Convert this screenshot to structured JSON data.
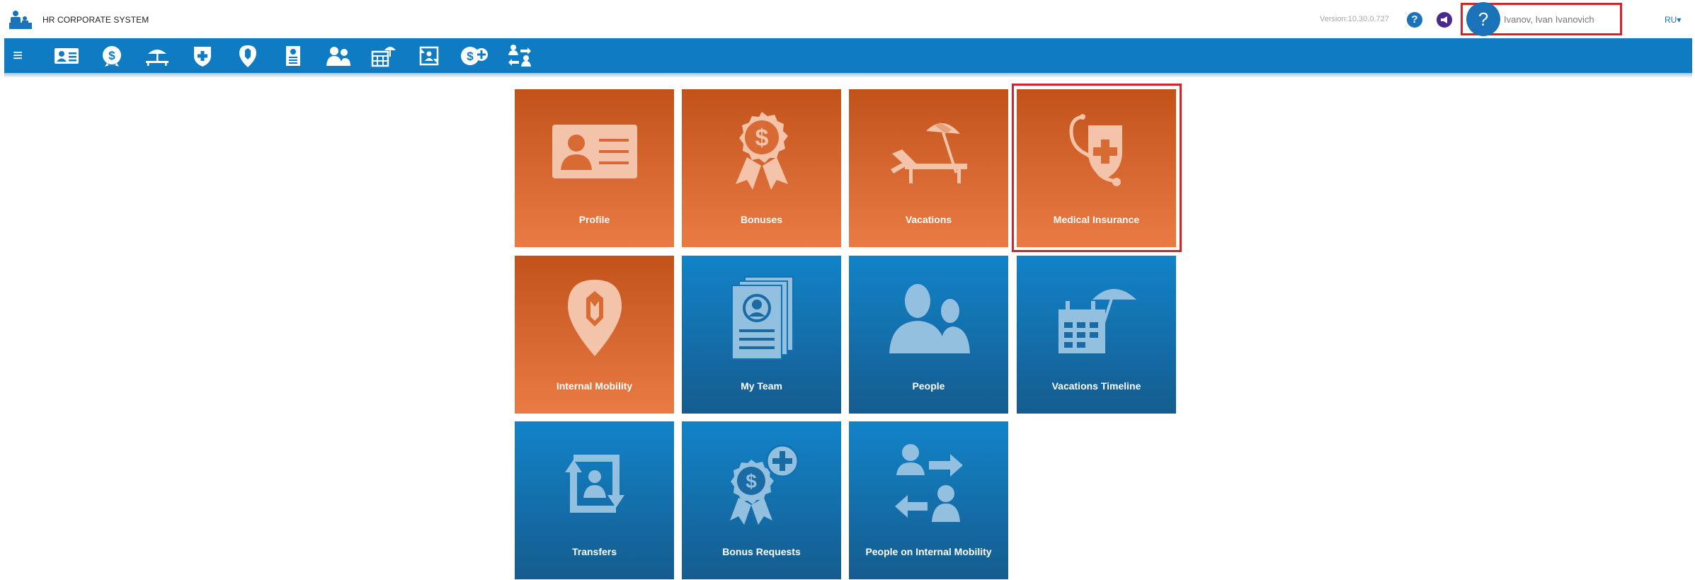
{
  "header": {
    "app_title": "HR CORPORATE SYSTEM",
    "version": "Version:10.30.0.727",
    "help_glyph": "?",
    "user_help_glyph": "?",
    "user_name": "Ivanov, Ivan Ivanovich",
    "language": "RU▾"
  },
  "navbar": {
    "menu_glyph": "≡",
    "icons": [
      "profile-card-icon",
      "dollar-badge-icon",
      "beach-umbrella-icon",
      "shield-plus-icon",
      "map-pin-icon",
      "document-list-icon",
      "people-icon",
      "calendar-umbrella-icon",
      "transfer-icon",
      "dollar-plus-icon",
      "people-transfer-icon"
    ]
  },
  "tiles": [
    {
      "label": "Profile",
      "color": "orange",
      "icon": "id-card-icon"
    },
    {
      "label": "Bonuses",
      "color": "orange",
      "icon": "award-ribbon-icon"
    },
    {
      "label": "Vacations",
      "color": "orange",
      "icon": "beach-chair-icon"
    },
    {
      "label": "Medical Insurance",
      "color": "orange",
      "icon": "medical-shield-icon",
      "highlighted": true
    },
    {
      "label": "Internal Mobility",
      "color": "orange",
      "icon": "location-pin-icon"
    },
    {
      "label": "My Team",
      "color": "blue",
      "icon": "team-documents-icon"
    },
    {
      "label": "People",
      "color": "blue",
      "icon": "people-silhouette-icon"
    },
    {
      "label": "Vacations Timeline",
      "color": "blue",
      "icon": "calendar-umbrella-icon"
    },
    {
      "label": "Transfers",
      "color": "blue",
      "icon": "transfer-arrows-icon"
    },
    {
      "label": "Bonus Requests",
      "color": "blue",
      "icon": "award-plus-icon"
    },
    {
      "label": "People on Internal Mobility",
      "color": "blue",
      "icon": "people-arrows-icon"
    }
  ],
  "colors": {
    "nav_blue": "#0f7bc3",
    "tile_orange_top": "#c2521a",
    "tile_orange_bottom": "#ea7b45",
    "tile_blue_top": "#1283c8",
    "tile_blue_bottom": "#155c8f",
    "highlight_red": "#d3242b",
    "icon_orange": "#f3c4a9",
    "icon_blue": "#94c0df"
  }
}
